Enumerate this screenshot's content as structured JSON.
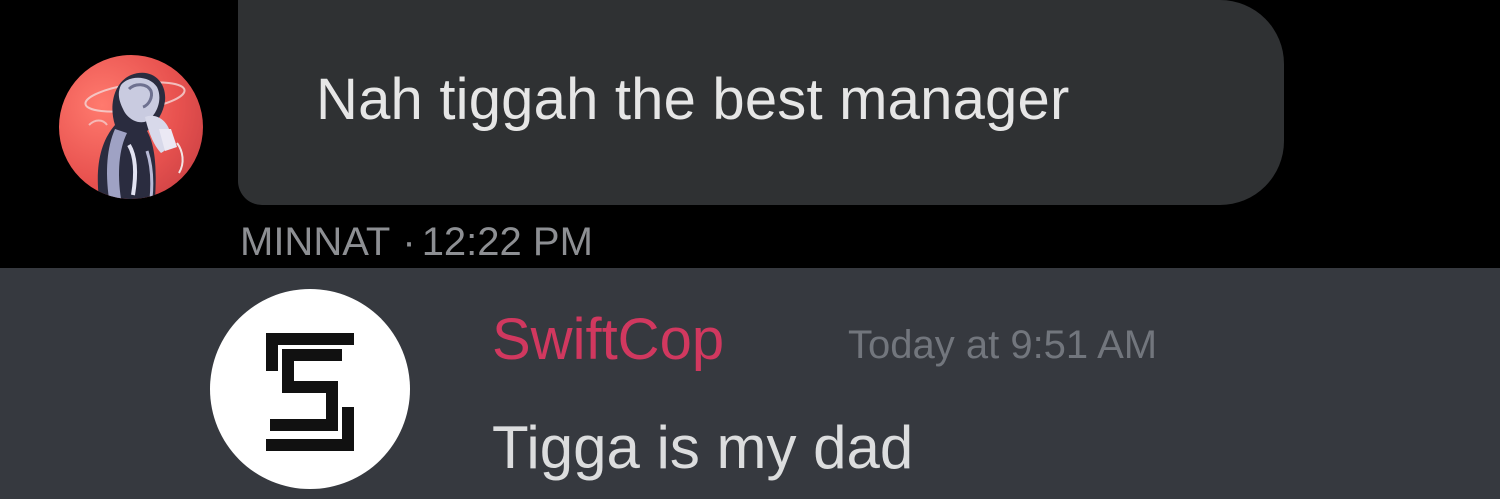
{
  "top_message": {
    "text": "Nah tiggah the best manager",
    "sender": "MINNAT",
    "separator": "·",
    "time": "12:22 PM",
    "avatar_icon": "stylized-figure-avatar-icon"
  },
  "bottom_message": {
    "username": "SwiftCop",
    "timestamp": "Today at 9:51 AM",
    "text": "Tigga is my dad",
    "avatar_icon": "s-logo-avatar-icon"
  },
  "colors": {
    "top_background": "#000000",
    "bubble": "#2f3133",
    "bottom_background": "#36393f",
    "username": "#d1385f"
  }
}
